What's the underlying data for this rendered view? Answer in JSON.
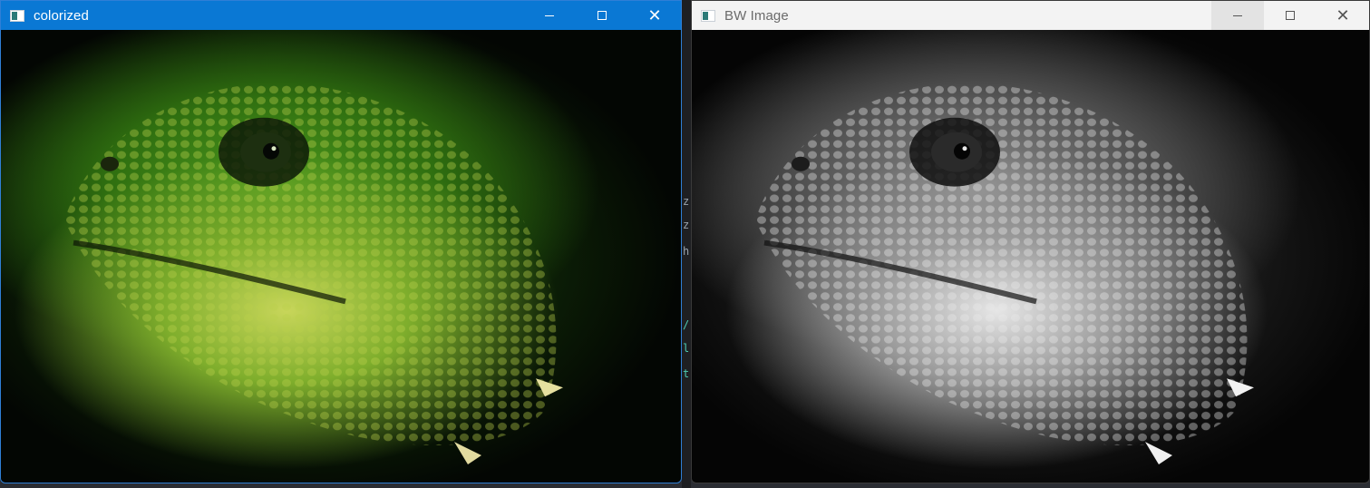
{
  "windows": {
    "colorized": {
      "title": "colorized"
    },
    "bw": {
      "title": "BW Image"
    }
  },
  "background_editor": {
    "code_chars": [
      "z",
      "z",
      "h",
      "/",
      "l",
      "t"
    ]
  },
  "colors": {
    "active_titlebar": "#0a78d4",
    "inactive_titlebar": "#f3f3f3",
    "lizard_green": "#7fae2c",
    "lizard_yellow": "#c8d65a"
  },
  "icons": {
    "app": "opencv-window-icon",
    "minimize": "minimize-icon",
    "maximize": "maximize-icon",
    "close": "close-icon"
  }
}
